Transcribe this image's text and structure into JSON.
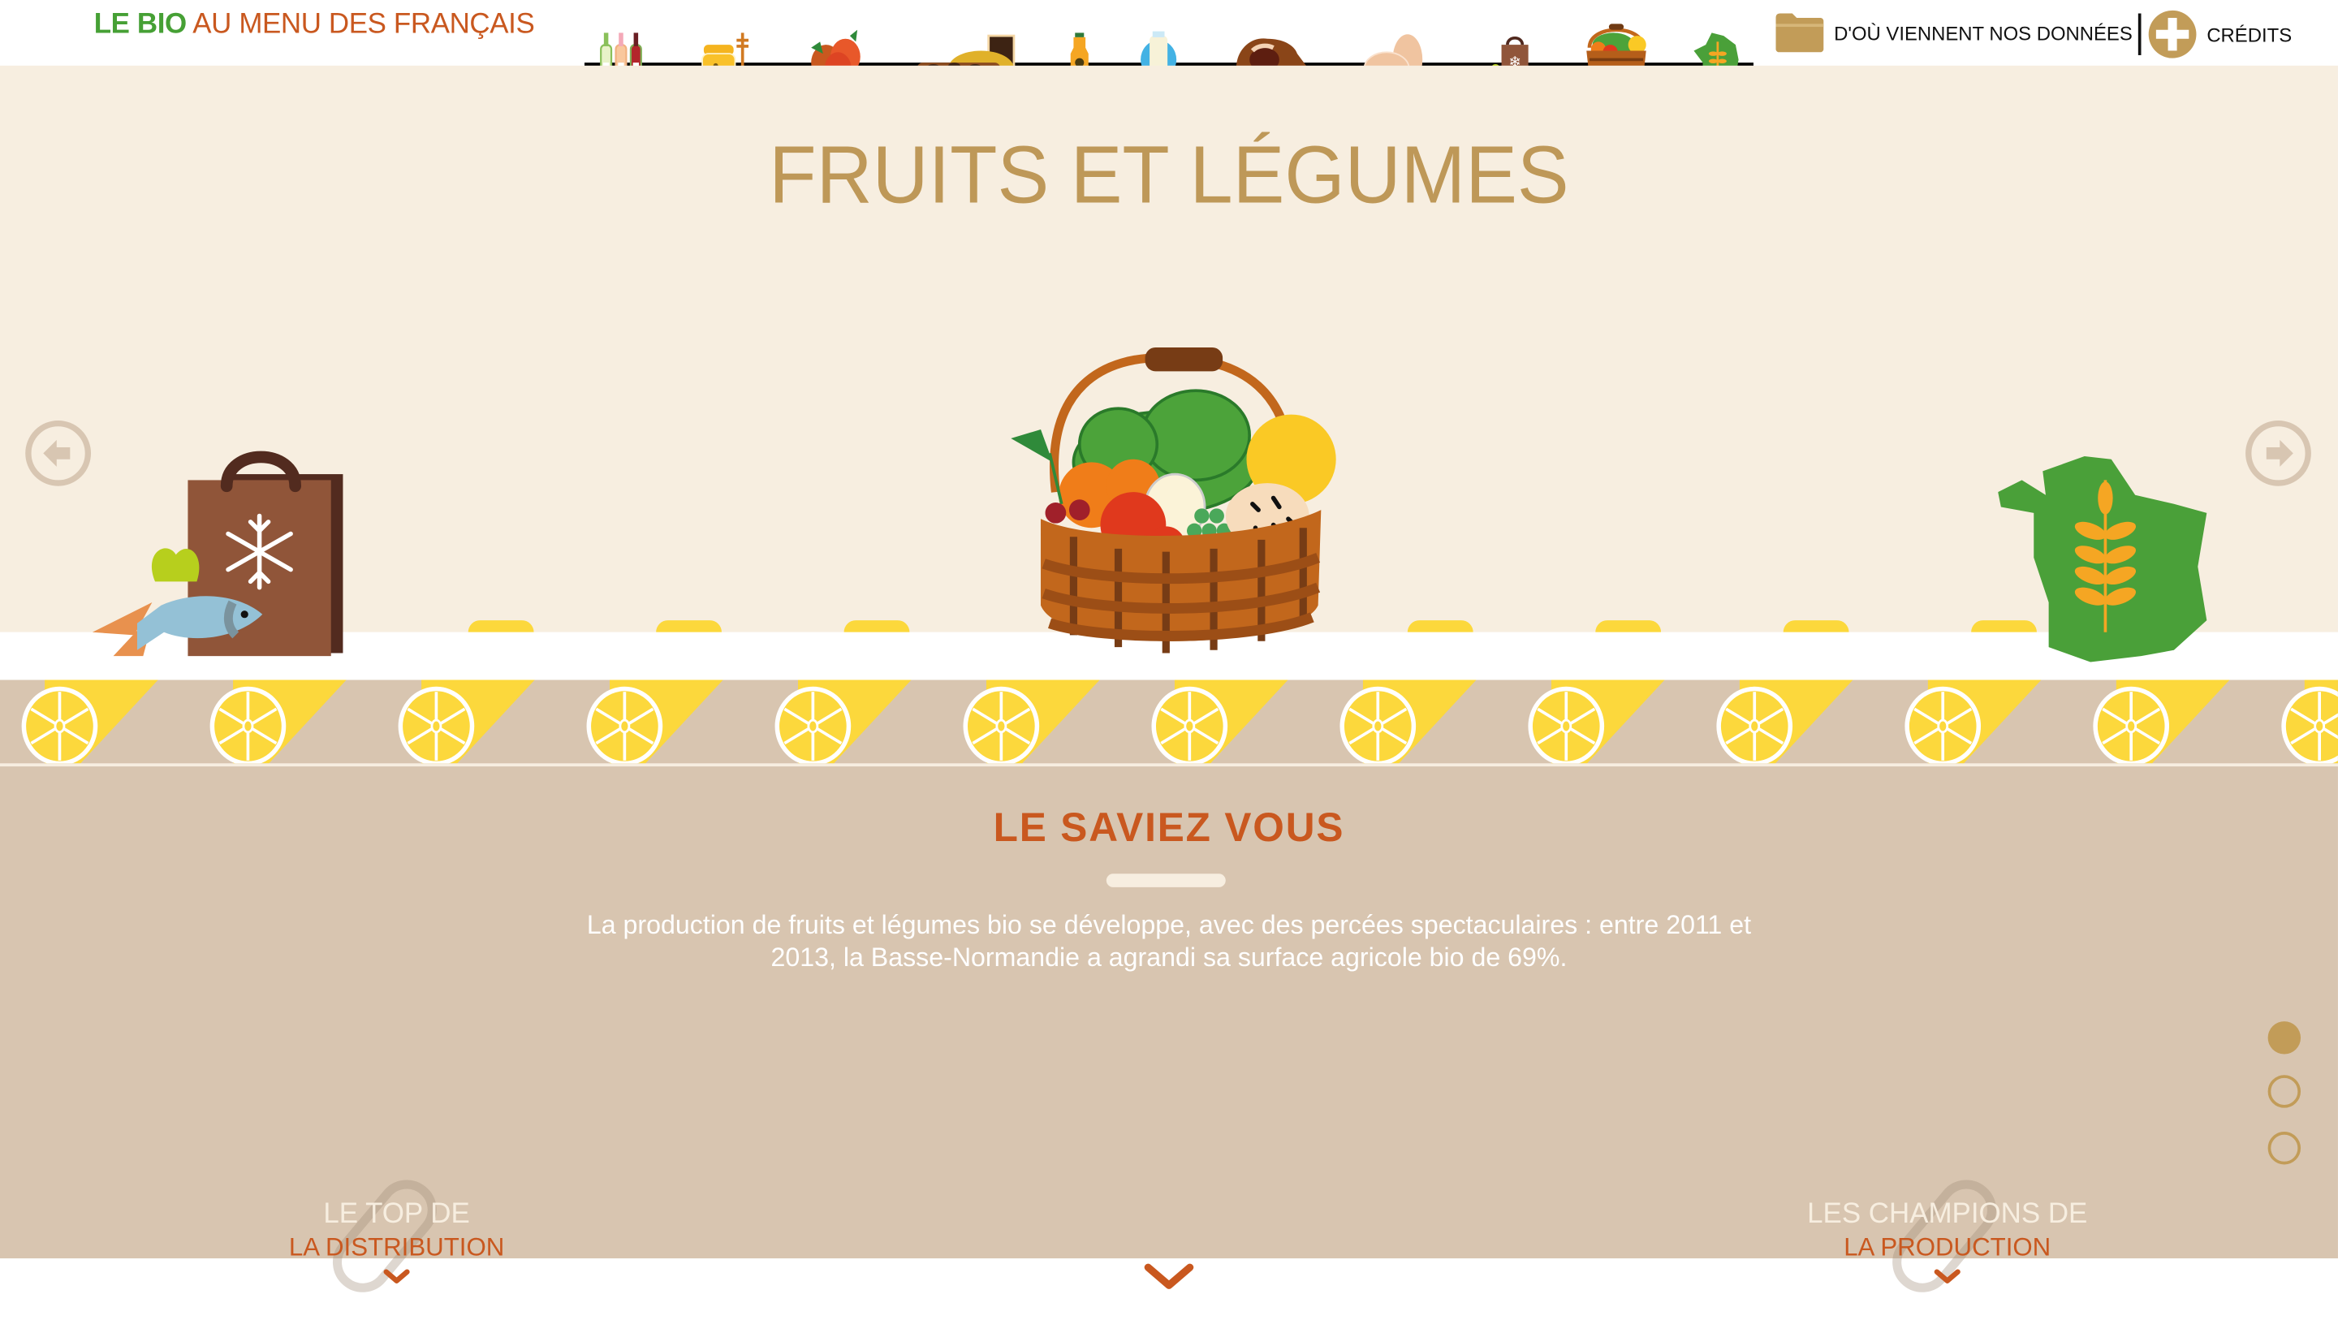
{
  "header": {
    "brand_bold": "LE BIO",
    "brand_rest": " AU MENU DES FRANÇAIS",
    "nav_items": [
      {
        "name": "vins",
        "icon": "wine-bottles-icon"
      },
      {
        "name": "miel",
        "icon": "honey-jar-icon"
      },
      {
        "name": "pommes",
        "icon": "apples-icon"
      },
      {
        "name": "biscuits",
        "icon": "cakes-biscuits-icon"
      },
      {
        "name": "jus",
        "icon": "juice-bottle-icon"
      },
      {
        "name": "lait",
        "icon": "milk-bottle-icon"
      },
      {
        "name": "volaille",
        "icon": "roast-chicken-icon"
      },
      {
        "name": "oeufs",
        "icon": "eggs-icon"
      },
      {
        "name": "surgeles",
        "icon": "frozen-bag-icon"
      },
      {
        "name": "fruits-et-legumes",
        "icon": "vegetable-basket-icon",
        "active": true
      },
      {
        "name": "france",
        "icon": "france-map-icon"
      }
    ],
    "sources_label": "D'OÙ VIENNENT NOS DONNÉES",
    "credits_label": "CRÉDITS"
  },
  "hero": {
    "title": "FRUITS ET LÉGUMES",
    "prev_label": "previous",
    "next_label": "next"
  },
  "info": {
    "title": "LE SAVIEZ VOUS",
    "fact": "La production de fruits et légumes bio se développe, avec des percées spectaculaires : entre 2011 et 2013, la Basse-Normandie a agrandi sa surface agricole bio de 69%.",
    "pager": {
      "total": 3,
      "current": 1
    }
  },
  "bottom": {
    "left_line1": "LE TOP DE",
    "left_line2": "LA DISTRIBUTION",
    "right_line1": "LES CHAMPIONS DE",
    "right_line2": "LA PRODUCTION"
  },
  "colors": {
    "brand_green": "#46a035",
    "accent_orange": "#c9581f",
    "gold": "#be9858",
    "cream": "#f7eee0",
    "taupe": "#d8c5b0",
    "lemon": "#fcd83c"
  }
}
